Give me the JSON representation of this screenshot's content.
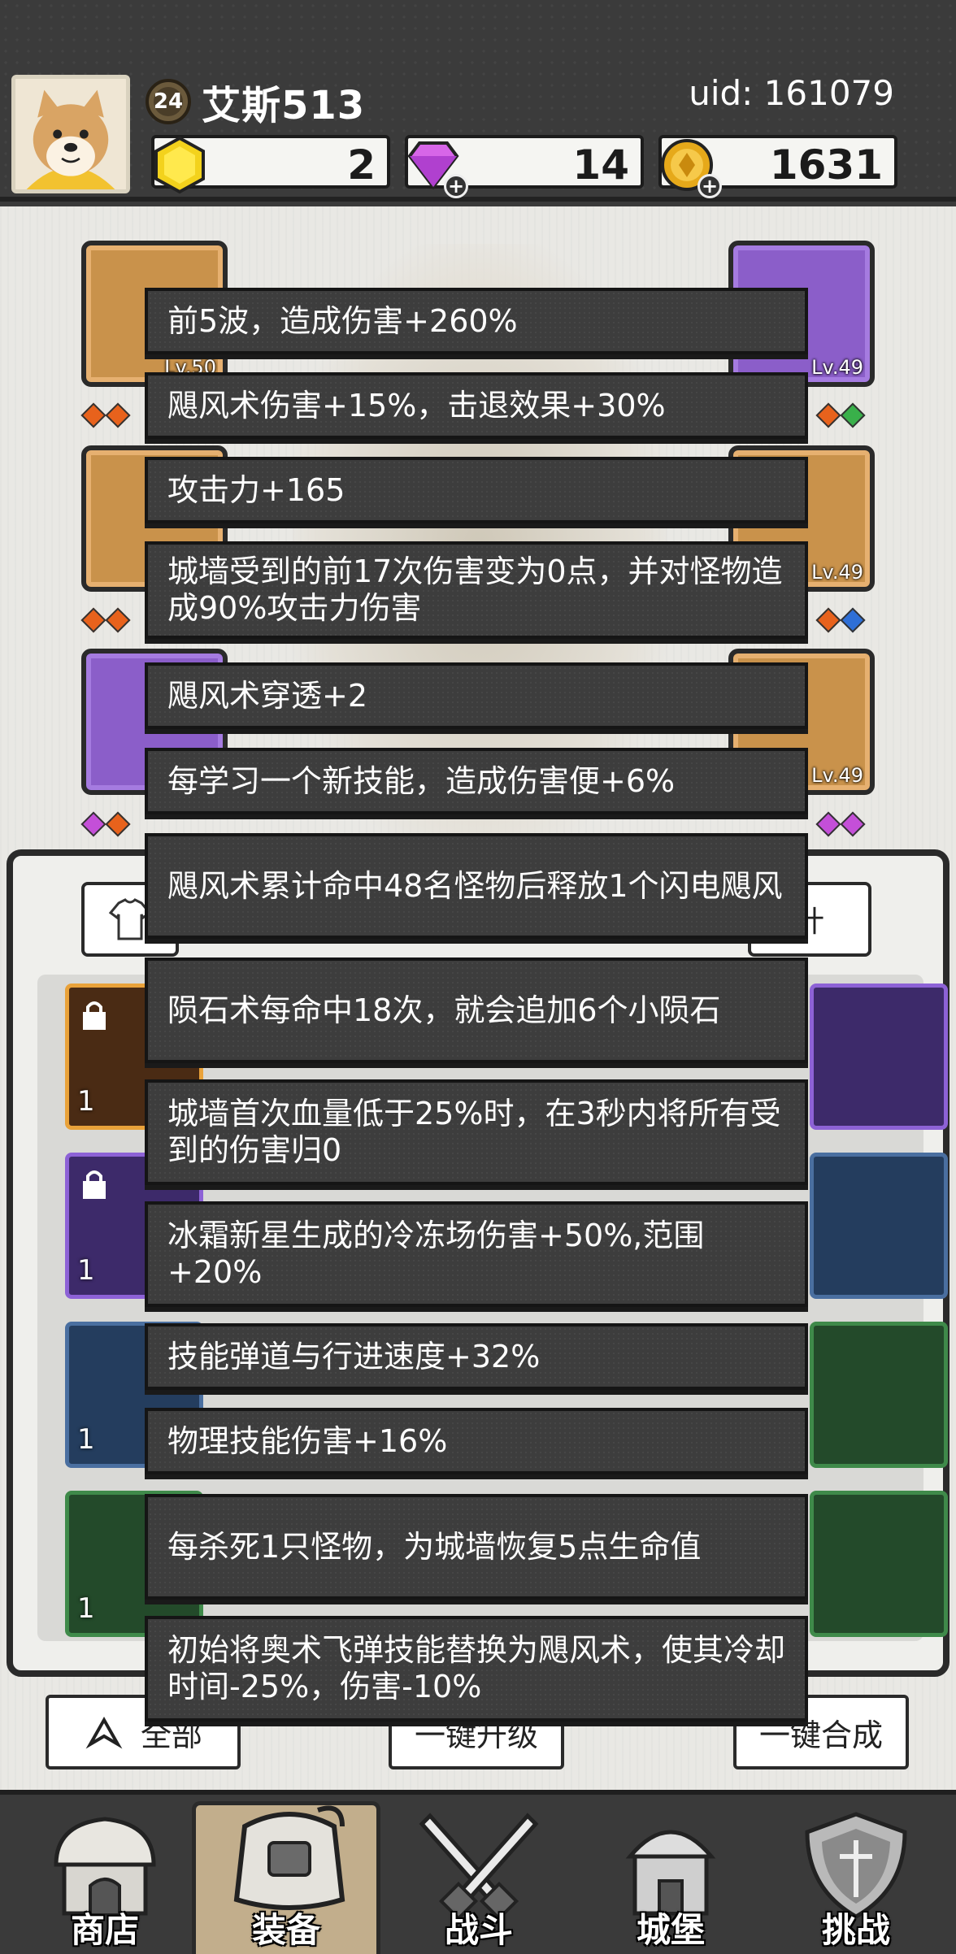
{
  "player": {
    "level": "24",
    "name": "艾斯513",
    "uid": "uid: 161079"
  },
  "resources": {
    "energy": "2",
    "gems": "14",
    "coins": "1631"
  },
  "equipment": {
    "left_slots": [
      {
        "level": "Lv.50"
      },
      {
        "level": ""
      },
      {
        "level": ""
      }
    ],
    "right_slots": [
      {
        "level": "Lv.49"
      },
      {
        "level": "Lv.49"
      },
      {
        "level": "Lv.49"
      }
    ]
  },
  "inventory": {
    "stats_button": "计",
    "item_counts": [
      "1",
      "1",
      "1",
      "1"
    ],
    "filter_all": "全部",
    "upgrade_all": "一键升级",
    "merge_all": "一键合成"
  },
  "tooltips": [
    "前5波，造成伤害+260%",
    "飓风术伤害+15%，击退效果+30%",
    "攻击力+165",
    "城墙受到的前17次伤害变为0点，并对怪物造成90%攻击力伤害",
    "飓风术穿透+2",
    "每学习一个新技能，造成伤害便+6%",
    "飓风术累计命中48名怪物后释放1个闪电飓风",
    "陨石术每命中18次，就会追加6个小陨石",
    "城墙首次血量低于25%时，在3秒内将所有受到的伤害归0",
    "冰霜新星生成的冷冻场伤害+50%,范围+20%",
    "技能弹道与行进速度+32%",
    "物理技能伤害+16%",
    "每杀死1只怪物，为城墙恢复5点生命值",
    "初始将奥术飞弹技能替换为飓风术，使其冷却时间-25%，伤害-10%"
  ],
  "nav": [
    {
      "label": "商店",
      "icon": "shop-icon"
    },
    {
      "label": "装备",
      "icon": "backpack-icon"
    },
    {
      "label": "战斗",
      "icon": "crossed-swords-icon"
    },
    {
      "label": "城堡",
      "icon": "castle-icon"
    },
    {
      "label": "挑战",
      "icon": "shield-icon"
    }
  ],
  "colors": {
    "tooltip_bg": "#3d3d3d",
    "gold_slot": "#c9924b",
    "purple_slot": "#8b5ec9",
    "nav_active": "#c2ae8c"
  }
}
